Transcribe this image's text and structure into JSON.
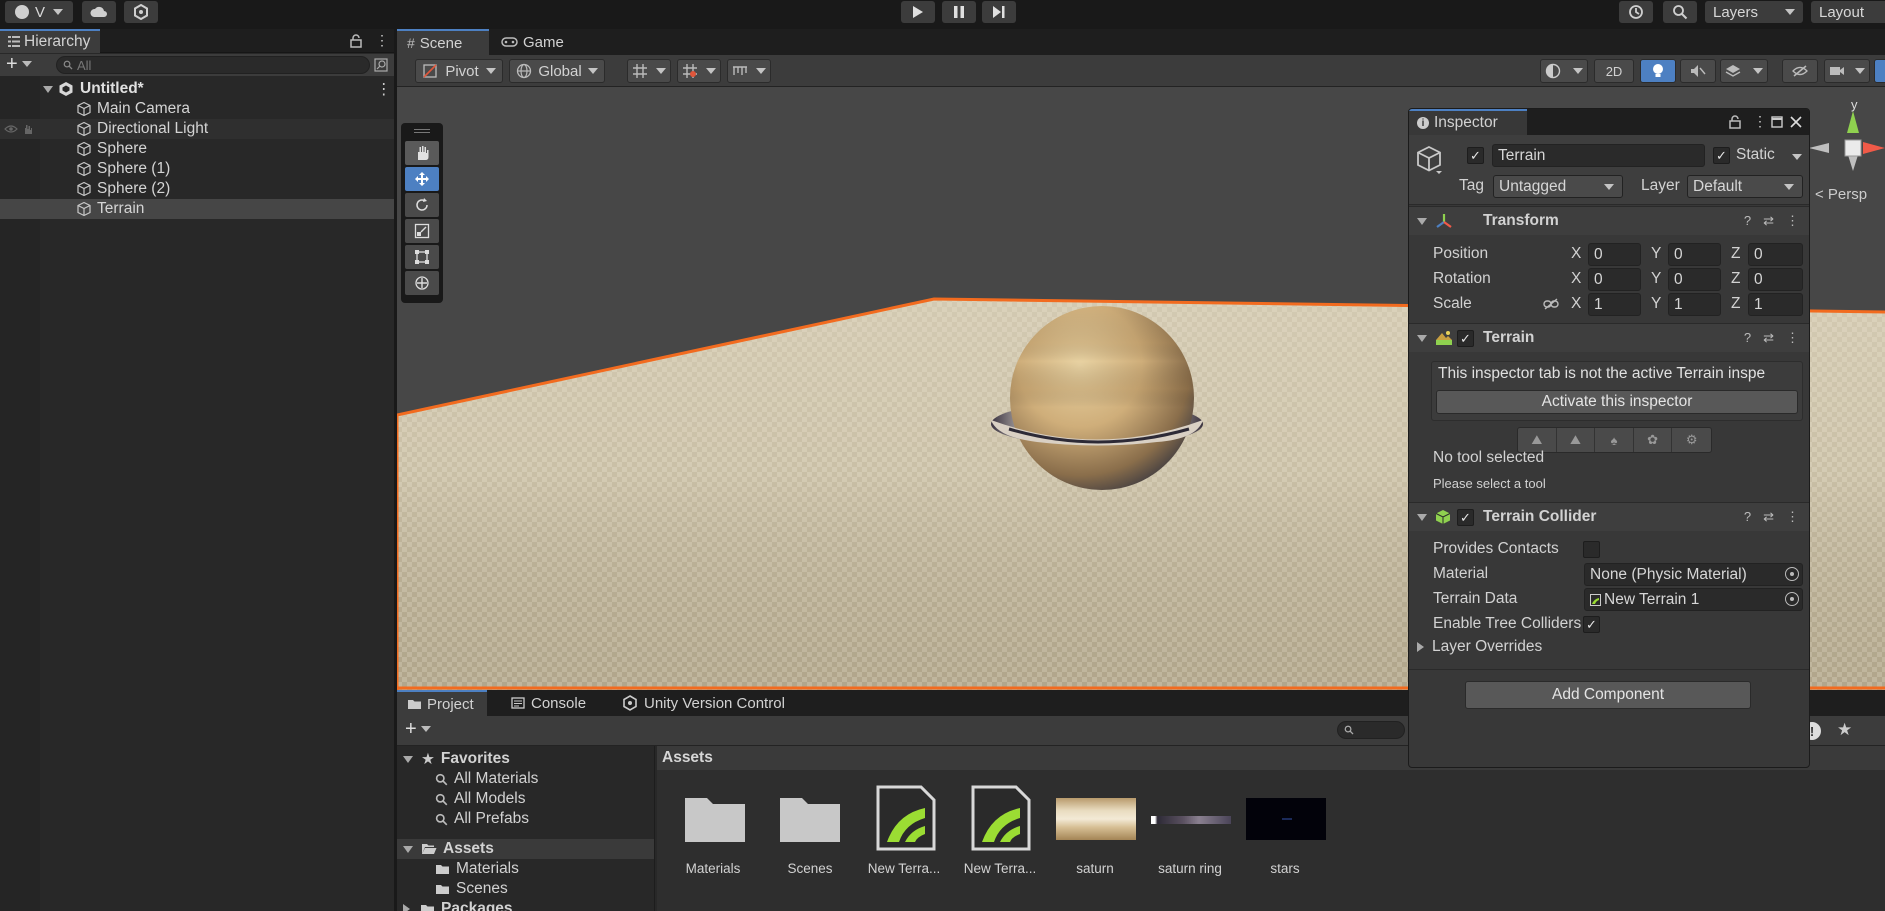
{
  "toolbar": {
    "account_label": "V",
    "layers_label": "Layers",
    "layout_label": "Layout"
  },
  "hierarchy": {
    "title": "Hierarchy",
    "search_placeholder": "All",
    "scene_name": "Untitled*",
    "items": [
      {
        "label": "Main Camera"
      },
      {
        "label": "Directional Light"
      },
      {
        "label": "Sphere"
      },
      {
        "label": "Sphere (1)"
      },
      {
        "label": "Sphere (2)"
      },
      {
        "label": "Terrain"
      }
    ]
  },
  "scene": {
    "tabs": [
      {
        "label": "Scene"
      },
      {
        "label": "Game"
      }
    ],
    "pivot_label": "Pivot",
    "global_label": "Global",
    "mode_2d": "2D",
    "persp_label": "< Persp",
    "gizmo_y": "y"
  },
  "inspector": {
    "title": "Inspector",
    "object_name": "Terrain",
    "static_label": "Static",
    "tag_label": "Tag",
    "tag_value": "Untagged",
    "layer_label": "Layer",
    "layer_value": "Default",
    "transform": {
      "title": "Transform",
      "position_label": "Position",
      "rotation_label": "Rotation",
      "scale_label": "Scale",
      "axis_x": "X",
      "axis_y": "Y",
      "axis_z": "Z",
      "position": {
        "x": "0",
        "y": "0",
        "z": "0"
      },
      "rotation": {
        "x": "0",
        "y": "0",
        "z": "0"
      },
      "scale": {
        "x": "1",
        "y": "1",
        "z": "1"
      }
    },
    "terrain": {
      "title": "Terrain",
      "notice": "This inspector tab is not the active Terrain inspe",
      "activate_label": "Activate this inspector",
      "no_tool": "No tool selected",
      "please_select": "Please select a tool"
    },
    "collider": {
      "title": "Terrain Collider",
      "provides_contacts": "Provides Contacts",
      "material_label": "Material",
      "material_value": "None (Physic Material)",
      "terrain_data_label": "Terrain Data",
      "terrain_data_value": "New Terrain 1",
      "enable_tree_colliders": "Enable Tree Colliders",
      "layer_overrides": "Layer Overrides"
    },
    "add_component": "Add Component"
  },
  "project": {
    "tabs": [
      {
        "label": "Project"
      },
      {
        "label": "Console"
      },
      {
        "label": "Unity Version Control"
      }
    ],
    "favorites_label": "Favorites",
    "favorites": [
      {
        "label": "All Materials"
      },
      {
        "label": "All Models"
      },
      {
        "label": "All Prefabs"
      }
    ],
    "assets_label": "Assets",
    "asset_folders": [
      {
        "label": "Materials"
      },
      {
        "label": "Scenes"
      }
    ],
    "packages_label": "Packages",
    "breadcrumb": "Assets",
    "items": [
      {
        "label": "Materials",
        "kind": "folder"
      },
      {
        "label": "Scenes",
        "kind": "folder"
      },
      {
        "label": "New Terra...",
        "kind": "terrain"
      },
      {
        "label": "New Terra...",
        "kind": "terrain"
      },
      {
        "label": "saturn",
        "kind": "texture"
      },
      {
        "label": "saturn ring",
        "kind": "texture"
      },
      {
        "label": "stars",
        "kind": "texture"
      }
    ]
  },
  "colors": {
    "accent_blue": "#4d80c2",
    "selection_orange": "#f26b1f",
    "panel_bg": "#383838"
  }
}
